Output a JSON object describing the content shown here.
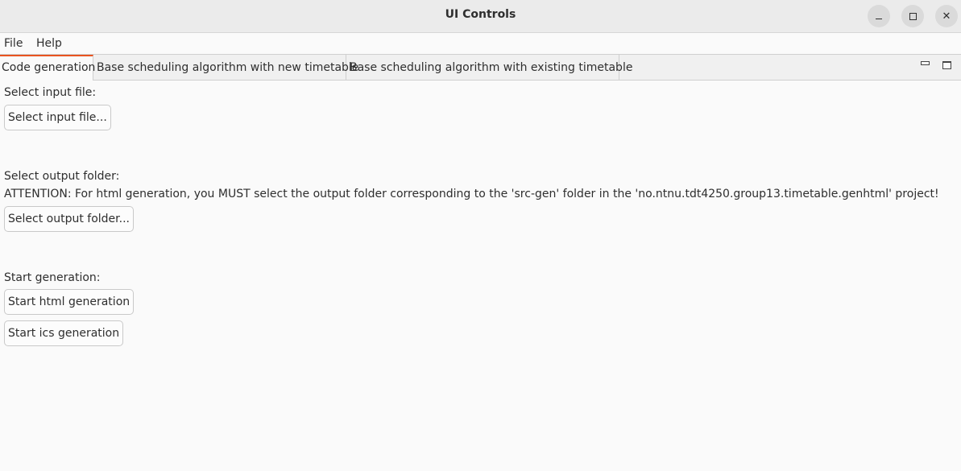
{
  "window": {
    "title": "UI Controls"
  },
  "menubar": {
    "items": [
      {
        "label": "File"
      },
      {
        "label": "Help"
      }
    ]
  },
  "tabs": [
    {
      "label": "Code generation",
      "active": true
    },
    {
      "label": "Base scheduling algorithm with new timetable",
      "active": false
    },
    {
      "label": "Base scheduling algorithm with existing timetable",
      "active": false
    }
  ],
  "main": {
    "input_section_label": "Select input file:",
    "input_button_label": "Select input file...",
    "output_section_label": "Select output folder:",
    "attention_text": "ATTENTION: For html generation, you MUST select the output folder corresponding to the 'src-gen' folder in the 'no.ntnu.tdt4250.group13.timetable.genhtml' project!",
    "output_button_label": "Select output folder...",
    "generation_section_label": "Start generation:",
    "html_button_label": "Start html generation",
    "ics_button_label": "Start ics generation"
  },
  "colors": {
    "accent": "#e95420",
    "background": "#fafafa",
    "titlebar": "#ebebeb"
  },
  "icons": {
    "window_minimize": "minimize-icon",
    "window_maximize": "maximize-icon",
    "window_close": "close-icon",
    "tab_minimize": "tab-minimize-icon",
    "tab_maximize": "tab-maximize-icon"
  }
}
